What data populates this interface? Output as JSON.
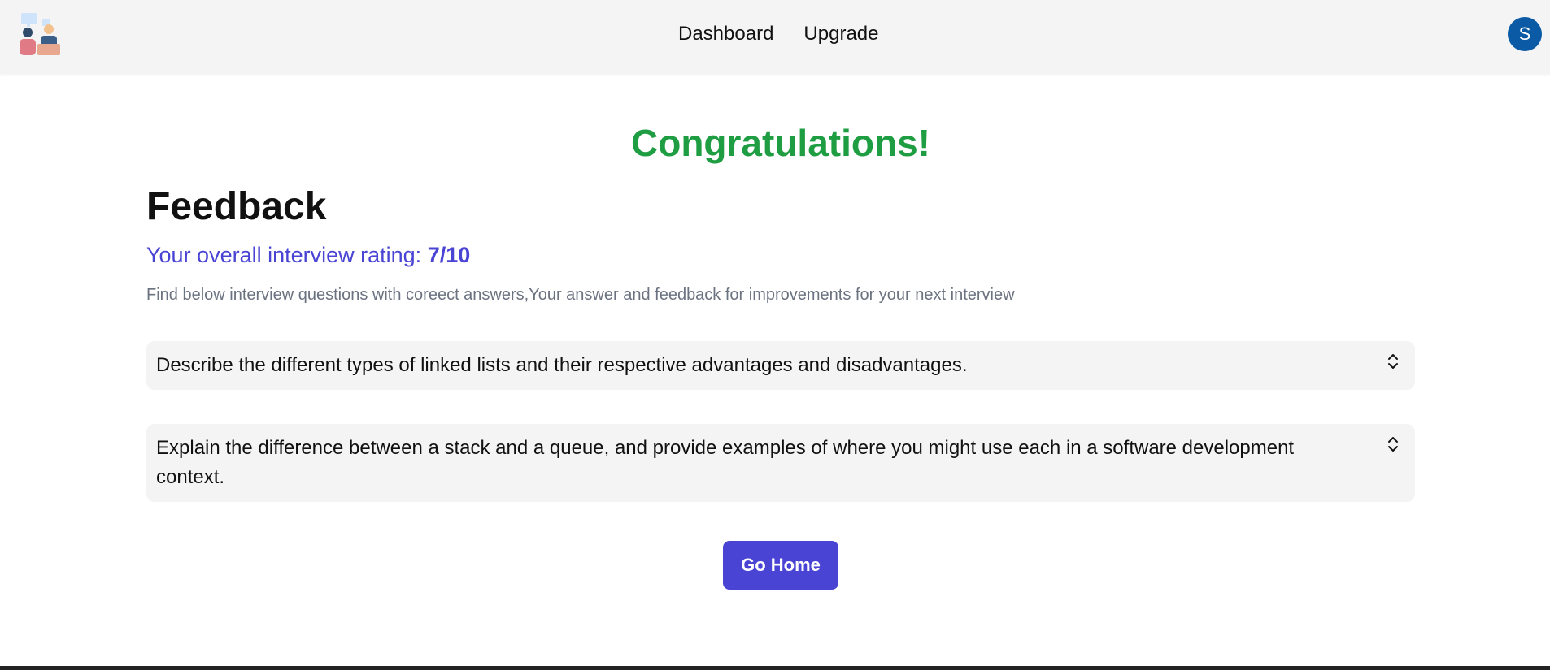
{
  "header": {
    "logo_icon": "interview-people-icon",
    "nav": [
      {
        "label": "Dashboard"
      },
      {
        "label": "Upgrade"
      }
    ],
    "avatar_initial": "S"
  },
  "main": {
    "congrats": "Congratulations!",
    "title": "Feedback",
    "rating_prefix": "Your overall interview rating: ",
    "rating_value": "7/10",
    "subtitle": "Find below interview questions with coreect answers,Your answer and feedback for improvements for your next interview",
    "questions": [
      {
        "text": "Describe the different types of linked lists and their respective advantages and disadvantages.",
        "icon": "chevron-up-down-icon"
      },
      {
        "text": "Explain the difference between a stack and a queue, and provide examples of where you might use each in a software development context.",
        "icon": "chevron-up-down-icon"
      }
    ],
    "go_home_label": "Go Home"
  },
  "colors": {
    "accent": "#4a44d4",
    "success": "#1f9d43",
    "avatar_bg": "#0b5aa6",
    "topbar_bg": "#f4f4f4",
    "card_bg": "#f4f4f4",
    "muted_text": "#6b7280"
  }
}
